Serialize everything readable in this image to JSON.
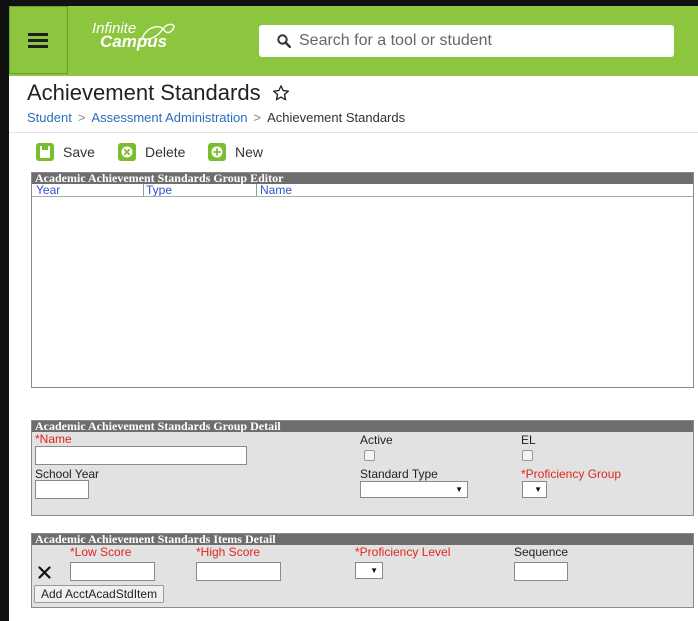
{
  "header": {
    "logo_line1": "Infinite",
    "logo_line2": "Campus",
    "search_placeholder": "Search for a tool or student",
    "accent_color": "#8cc63f"
  },
  "page": {
    "title": "Achievement Standards"
  },
  "breadcrumb": [
    "Student",
    "Assessment Administration",
    "Achievement Standards"
  ],
  "toolbar": {
    "save_label": "Save",
    "delete_label": "Delete",
    "new_label": "New"
  },
  "group_editor": {
    "title": "Academic Achievement Standards Group Editor",
    "columns": [
      "Year",
      "Type",
      "Name"
    ],
    "rows": []
  },
  "group_detail": {
    "title": "Academic Achievement Standards Group Detail",
    "name_label": "*Name",
    "name_value": "",
    "active_label": "Active",
    "active_checked": false,
    "el_label": "EL",
    "el_checked": false,
    "school_year_label": "School Year",
    "school_year_value": "",
    "standard_type_label": "Standard Type",
    "standard_type_value": "",
    "proficiency_group_label": "*Proficiency Group",
    "proficiency_group_value": ""
  },
  "items_detail": {
    "title": "Academic Achievement Standards Items Detail",
    "low_score_label": "*Low Score",
    "high_score_label": "*High Score",
    "proficiency_level_label": "*Proficiency Level",
    "sequence_label": "Sequence",
    "low_score_value": "",
    "high_score_value": "",
    "sequence_value": "",
    "add_button_label": "Add AcctAcadStdItem"
  },
  "icons": {
    "menu": "hamburger-icon",
    "search": "search-icon",
    "favorite": "star-outline-icon",
    "save": "floppy-disk-icon",
    "delete": "x-circle-icon",
    "new": "plus-circle-icon",
    "remove_row": "x-icon"
  }
}
